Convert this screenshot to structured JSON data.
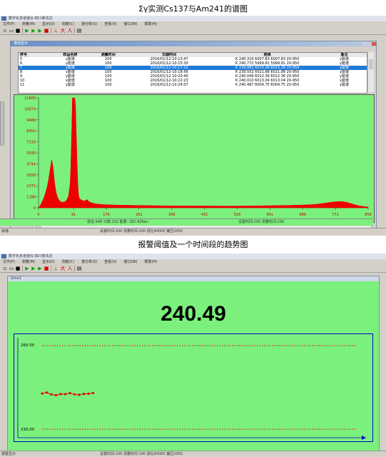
{
  "captions": {
    "top": "Σγ实测Cs137与Am241的谱图",
    "middle": "报警阈值及一个时间段的趋势图"
  },
  "app1": {
    "title": "数字化多道谱仪-四川新先达",
    "menu": [
      "文件(F)",
      "测量(M)",
      "显示(D)",
      "刻度(C)",
      "谱分析(S)",
      "查看(V)",
      "窗口(W)",
      "帮助(H)"
    ],
    "window_title": "谱线显示",
    "table": {
      "headers": [
        "序号",
        "样品名称",
        "测量时间",
        "日期时间",
        "结果",
        "备注"
      ],
      "rows": [
        [
          "5",
          "γ能谱",
          "100",
          "2016/01/12-10:13:47",
          "K 240.310 6007.83 6007.83 20-950",
          "γ能谱"
        ],
        [
          "6",
          "γ能谱",
          "100",
          "2016/01/12-10:15:30",
          "K 240.772 5999.81 5999.81 20-950",
          "γ能谱"
        ],
        [
          "7",
          "γ能谱",
          "100",
          "2016/01/12-10:17:13",
          "K 239.881 6015.28 6015.28 20-950",
          "γ能谱"
        ],
        [
          "8",
          "γ能谱",
          "100",
          "2016/01/12-10:18:56",
          "K 239.502 6021.88 6021.88 20-950",
          "γ能谱"
        ],
        [
          "9",
          "γ能谱",
          "100",
          "2016/01/12-10:20:40",
          "K 240.049 6012.36 6012.36 20-950",
          "γ能谱"
        ],
        [
          "10",
          "γ能谱",
          "100",
          "2016/01/12-10:22:23",
          "K 240.010 6013.04 6013.04 20-950",
          "γ能谱"
        ],
        [
          "11",
          "γ能谱",
          "100",
          "2016/01/12-10:24:07",
          "K 240.487 6004.75 6004.75 20-950",
          "γ能谱"
        ]
      ],
      "selected_row": 2
    },
    "spectrum_status_left": "道址:548 计数:132 能量: 282.42Kev",
    "spectrum_status_right": "设置时间:100 测量时间:100",
    "status_left": "就绪",
    "status_right": "设置时间:100 测量时间:100 道址40000 偏压2050"
  },
  "app2": {
    "title": "数字化多道谱仪-四川新先达",
    "menu": [
      "文件(F)",
      "测量(M)",
      "显示(D)",
      "刻度(C)",
      "谱分析(S)",
      "查看(V)",
      "窗口(W)",
      "帮助(H)"
    ],
    "window_title": "Gmx1",
    "big_value": "240.49",
    "status_left": "报警显示",
    "status_right": "设置时间:100 测量时间:100 道址40000 偏压2050"
  },
  "colors": {
    "plot_bg": "#7cf07c",
    "spectrum": "#ee0000",
    "selection": "#1e7bd8",
    "trend_line": "#e00000",
    "threshold": "#e00000",
    "axis_blue": "#0000d0"
  },
  "chart_data": [
    {
      "type": "area",
      "yticks": [
        0,
        1186,
        2372,
        3558,
        4744,
        5930,
        7116,
        8302,
        9488,
        10674,
        11860
      ],
      "xticks": [
        0,
        91,
        176,
        261,
        346,
        431,
        516,
        601,
        686,
        771,
        856
      ],
      "ylim": [
        0,
        11860
      ],
      "xlim": [
        0,
        856
      ],
      "x": [
        0,
        5,
        10,
        14,
        18,
        22,
        26,
        30,
        34,
        38,
        42,
        46,
        50,
        54,
        58,
        62,
        66,
        70,
        74,
        78,
        82,
        84,
        86,
        88,
        90,
        92,
        94,
        96,
        98,
        100,
        102,
        104,
        106,
        110,
        114,
        118,
        122,
        126,
        130,
        140,
        150,
        160,
        170,
        180,
        200,
        250,
        300,
        350,
        400,
        450,
        500,
        550,
        600,
        650,
        700,
        720,
        740,
        760,
        770,
        780,
        790,
        800,
        810,
        820,
        830,
        840,
        850,
        856
      ],
      "values": [
        0,
        300,
        700,
        1100,
        1600,
        2200,
        3000,
        4100,
        5200,
        4300,
        2600,
        1600,
        1050,
        800,
        650,
        600,
        620,
        700,
        900,
        1300,
        2600,
        4600,
        8000,
        11860,
        11860,
        11860,
        11860,
        11200,
        8000,
        5000,
        2600,
        1400,
        1000,
        880,
        800,
        750,
        780,
        900,
        700,
        500,
        420,
        380,
        350,
        330,
        300,
        260,
        230,
        210,
        200,
        190,
        185,
        200,
        230,
        260,
        320,
        380,
        480,
        600,
        650,
        680,
        660,
        600,
        480,
        350,
        240,
        160,
        110,
        100
      ]
    },
    {
      "type": "line",
      "ylim": [
        230,
        260
      ],
      "y_tick_labels": [
        "260.00",
        "230.00"
      ],
      "thresholds": [
        258.3,
        231.7
      ],
      "values": [
        240.31,
        240.77,
        239.88,
        239.5,
        240.05,
        240.01,
        240.49,
        239.9,
        239.7,
        240.1,
        240.2,
        240.49
      ]
    }
  ]
}
